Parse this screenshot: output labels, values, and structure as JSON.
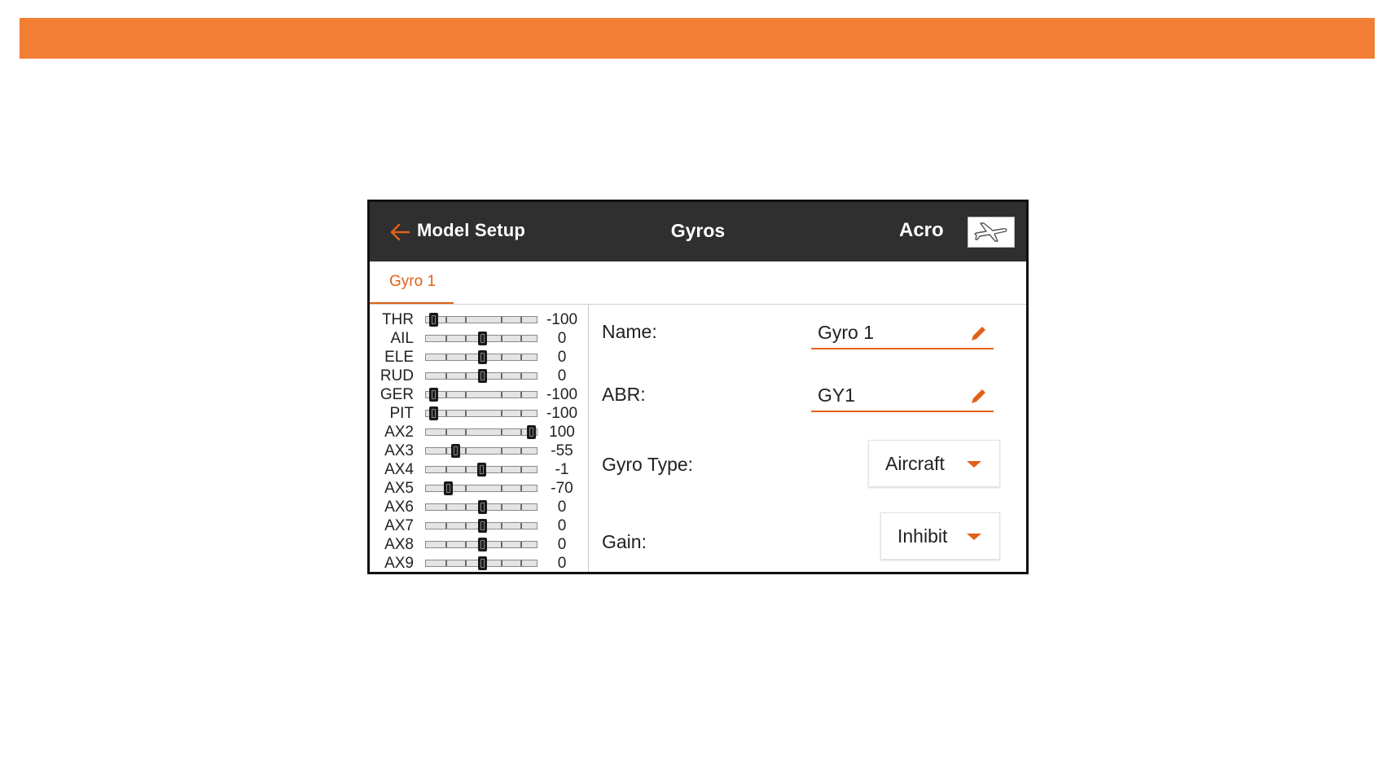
{
  "header": {
    "back_label": "Model Setup",
    "title": "Gyros",
    "model_name": "Acro",
    "model_icon": "airplane-icon"
  },
  "tabs": [
    {
      "label": "Gyro 1",
      "active": true
    }
  ],
  "channels": [
    {
      "name": "THR",
      "value": "-100",
      "level": -100
    },
    {
      "name": "AIL",
      "value": "0",
      "level": 0
    },
    {
      "name": "ELE",
      "value": "0",
      "level": 0
    },
    {
      "name": "RUD",
      "value": "0",
      "level": 0
    },
    {
      "name": "GER",
      "value": "-100",
      "level": -100
    },
    {
      "name": "PIT",
      "value": "-100",
      "level": -100
    },
    {
      "name": "AX2",
      "value": "100",
      "level": 100
    },
    {
      "name": "AX3",
      "value": "-55",
      "level": -55
    },
    {
      "name": "AX4",
      "value": "-1",
      "level": -1
    },
    {
      "name": "AX5",
      "value": "-70",
      "level": -70
    },
    {
      "name": "AX6",
      "value": "0",
      "level": 0
    },
    {
      "name": "AX7",
      "value": "0",
      "level": 0
    },
    {
      "name": "AX8",
      "value": "0",
      "level": 0
    },
    {
      "name": "AX9",
      "value": "0",
      "level": 0
    }
  ],
  "settings": {
    "name_label": "Name:",
    "name_value": "Gyro 1",
    "abr_label": "ABR:",
    "abr_value": "GY1",
    "gyro_type_label": "Gyro Type:",
    "gyro_type_value": "Aircraft",
    "gain_label": "Gain:",
    "gain_value": "Inhibit"
  },
  "colors": {
    "accent": "#e0611a",
    "banner": "#f27e33",
    "header_bg": "#2f2f2f"
  }
}
